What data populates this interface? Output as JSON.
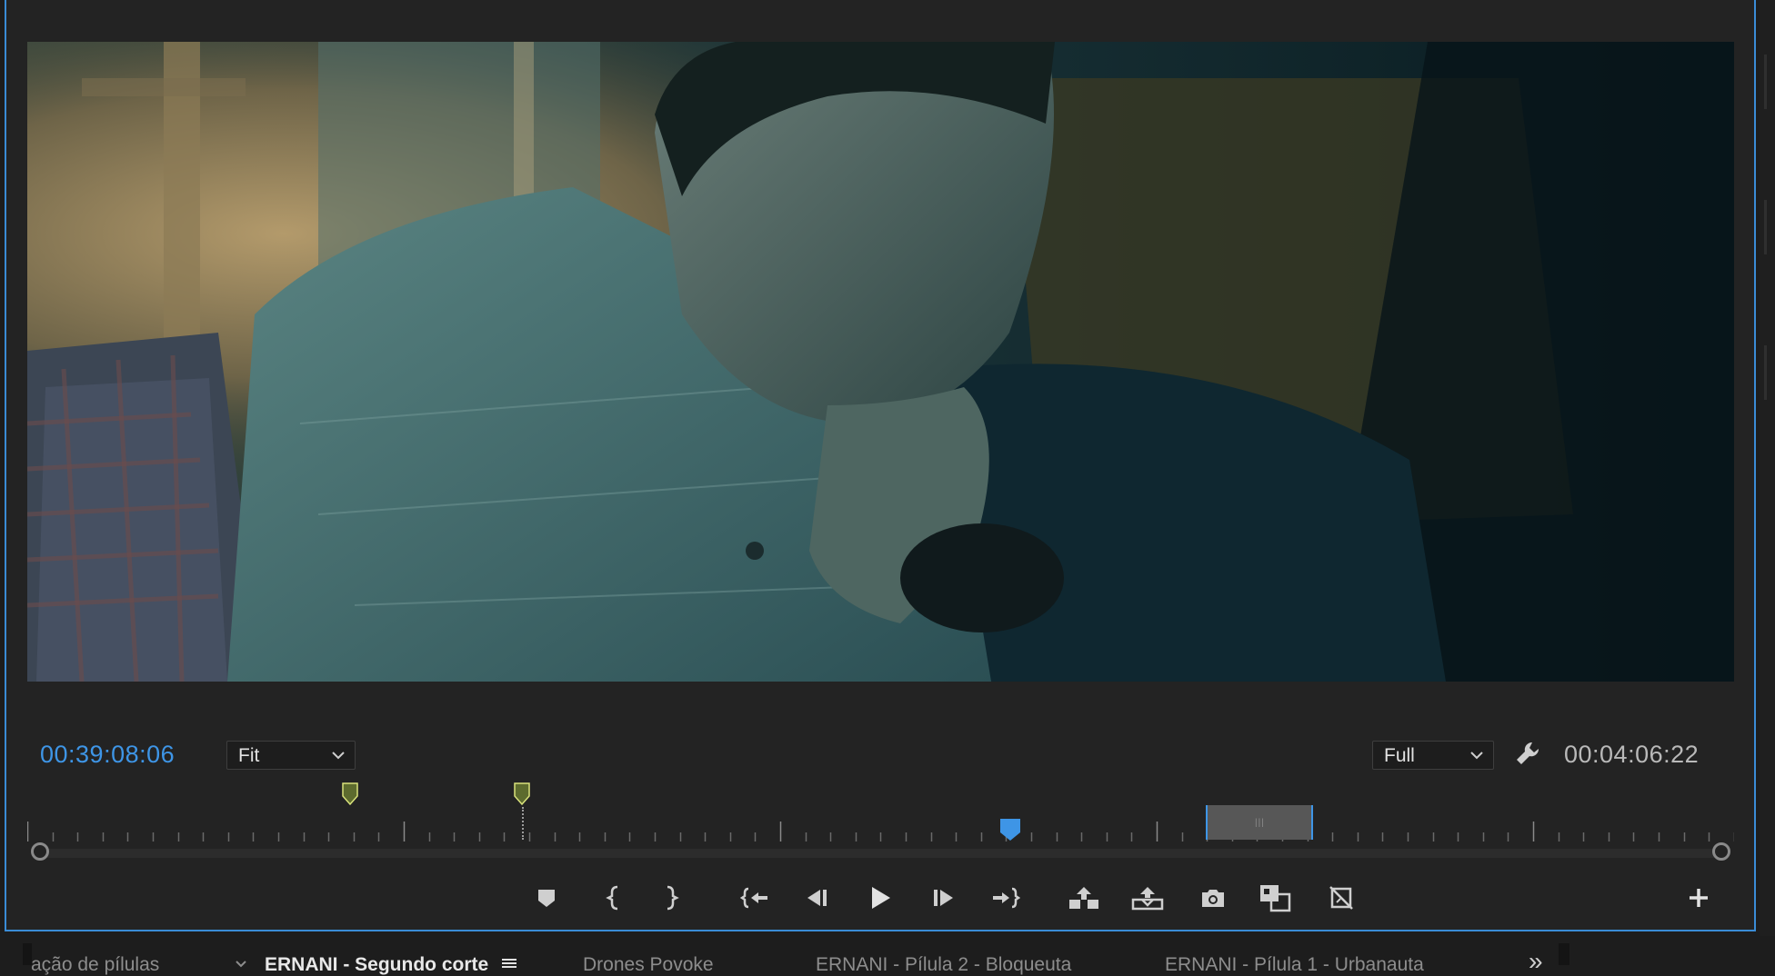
{
  "monitor": {
    "current_timecode": "00:39:08:06",
    "zoom_level": "Fit",
    "playback_resolution": "Full",
    "duration_timecode": "00:04:06:22"
  },
  "timeline": {
    "playhead_position_fraction": 0.577,
    "marker_positions_fraction": [
      0.19,
      0.29
    ],
    "work_area_fraction": [
      0.7,
      0.762
    ]
  },
  "controls": [
    {
      "name": "add-marker-button",
      "icon": "marker-icon"
    },
    {
      "name": "mark-in-button",
      "icon": "mark-in-icon"
    },
    {
      "name": "mark-out-button",
      "icon": "mark-out-icon"
    },
    {
      "name": "go-to-in-button",
      "icon": "go-to-in-icon"
    },
    {
      "name": "step-back-button",
      "icon": "step-back-icon"
    },
    {
      "name": "play-button",
      "icon": "play-icon"
    },
    {
      "name": "step-forward-button",
      "icon": "step-forward-icon"
    },
    {
      "name": "go-to-out-button",
      "icon": "go-to-out-icon"
    },
    {
      "name": "lift-button",
      "icon": "lift-icon"
    },
    {
      "name": "extract-button",
      "icon": "extract-icon"
    },
    {
      "name": "export-frame-button",
      "icon": "camera-icon"
    },
    {
      "name": "comparison-view-button",
      "icon": "comparison-icon"
    },
    {
      "name": "proxy-toggle-button",
      "icon": "proxy-icon"
    },
    {
      "name": "add-button",
      "icon": "plus-icon"
    }
  ],
  "tabs": {
    "tab1": "ação de pílulas",
    "tab2": "ERNANI - Segundo corte",
    "tab3": "Drones Povoke",
    "tab4": "ERNANI - Pílula 2 - Bloqueuta",
    "tab5": "ERNANI - Pílula 1 - Urbanauta",
    "overflow": "»"
  },
  "colors": {
    "accent": "#3e95e6",
    "marker": "#5d6b2e",
    "panel_bg": "#232323"
  }
}
